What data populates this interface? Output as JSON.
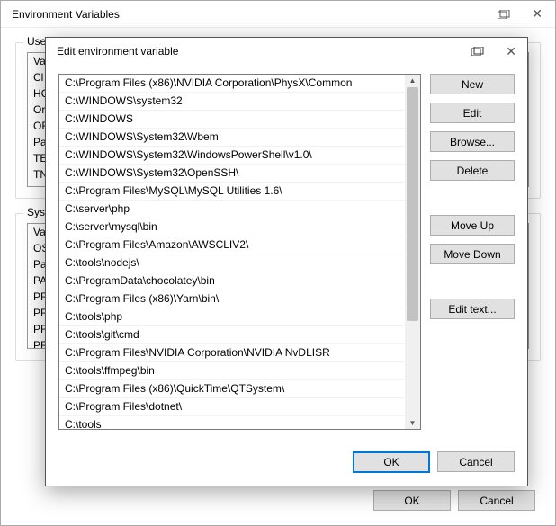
{
  "parent": {
    "title": "Environment Variables",
    "user_group_label": "User",
    "user_vars": [
      "Va",
      "Cl",
      "HC",
      "Or",
      "OF",
      "Pa",
      "TE",
      "TN"
    ],
    "sys_group_label": "Syste",
    "sys_vars": [
      "Va",
      "OS",
      "Pa",
      "PA",
      "PR",
      "PR",
      "PR",
      "PR"
    ],
    "ok": "OK",
    "cancel": "Cancel"
  },
  "child": {
    "title": "Edit environment variable",
    "paths": [
      "C:\\Program Files (x86)\\NVIDIA Corporation\\PhysX\\Common",
      "C:\\WINDOWS\\system32",
      "C:\\WINDOWS",
      "C:\\WINDOWS\\System32\\Wbem",
      "C:\\WINDOWS\\System32\\WindowsPowerShell\\v1.0\\",
      "C:\\WINDOWS\\System32\\OpenSSH\\",
      "C:\\Program Files\\MySQL\\MySQL Utilities 1.6\\",
      "C:\\server\\php",
      "C:\\server\\mysql\\bin",
      "C:\\Program Files\\Amazon\\AWSCLIV2\\",
      "C:\\tools\\nodejs\\",
      "C:\\ProgramData\\chocolatey\\bin",
      "C:\\Program Files (x86)\\Yarn\\bin\\",
      "C:\\tools\\php",
      "C:\\tools\\git\\cmd",
      "C:\\Program Files\\NVIDIA Corporation\\NVIDIA NvDLISR",
      "C:\\tools\\ffmpeg\\bin",
      "C:\\Program Files (x86)\\QuickTime\\QTSystem\\",
      "C:\\Program Files\\dotnet\\",
      "C:\\tools"
    ],
    "buttons": {
      "new": "New",
      "edit": "Edit",
      "browse": "Browse...",
      "delete": "Delete",
      "move_up": "Move Up",
      "move_down": "Move Down",
      "edit_text": "Edit text..."
    },
    "ok": "OK",
    "cancel": "Cancel"
  }
}
